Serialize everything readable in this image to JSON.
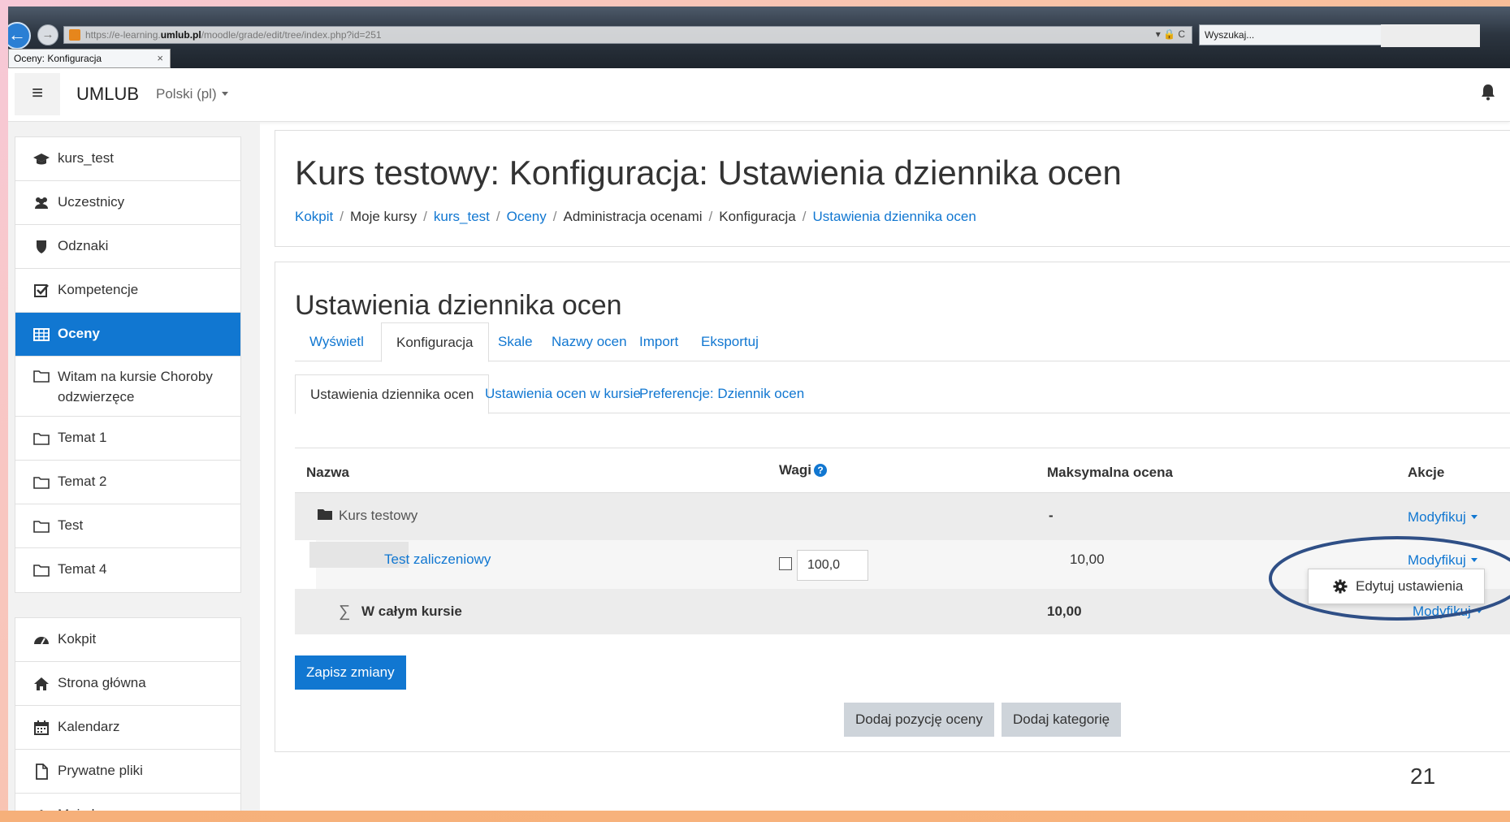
{
  "browser": {
    "url_prefix": "https://e-learning.",
    "url_domain": "umlub.pl",
    "url_path": "/moodle/grade/edit/tree/index.php?id=251",
    "addr_tools": "▾ 🔒 C",
    "search_placeholder": "Wyszukaj...",
    "tab_title": "Oceny: Konfiguracja",
    "tab_close": "×"
  },
  "navbar": {
    "menu_icon": "≡",
    "brand": "UMLUB",
    "language": "Polski (pl)"
  },
  "sidebar": {
    "course_items": [
      {
        "label": "kurs_test",
        "icon": "graduation-cap-icon"
      },
      {
        "label": "Uczestnicy",
        "icon": "users-icon"
      },
      {
        "label": "Odznaki",
        "icon": "shield-icon"
      },
      {
        "label": "Kompetencje",
        "icon": "check-square-icon"
      },
      {
        "label": "Oceny",
        "icon": "table-icon",
        "active": true
      },
      {
        "label": "Witam na kursie Choroby odzwierzęce",
        "icon": "folder-icon"
      },
      {
        "label": "Temat 1",
        "icon": "folder-icon"
      },
      {
        "label": "Temat 2",
        "icon": "folder-icon"
      },
      {
        "label": "Test",
        "icon": "folder-icon"
      },
      {
        "label": "Temat 4",
        "icon": "folder-icon"
      }
    ],
    "site_items": [
      {
        "label": "Kokpit",
        "icon": "dashboard-icon"
      },
      {
        "label": "Strona główna",
        "icon": "home-icon"
      },
      {
        "label": "Kalendarz",
        "icon": "calendar-icon"
      },
      {
        "label": "Prywatne pliki",
        "icon": "file-icon"
      },
      {
        "label": "Moje kursy",
        "icon": "graduation-cap-icon"
      }
    ]
  },
  "header": {
    "title": "Kurs testowy: Konfiguracja: Ustawienia dziennika ocen",
    "breadcrumb": [
      {
        "label": "Kokpit",
        "link": true
      },
      {
        "label": "Moje kursy",
        "link": false
      },
      {
        "label": "kurs_test",
        "link": true
      },
      {
        "label": "Oceny",
        "link": true
      },
      {
        "label": "Administracja ocenami",
        "link": false
      },
      {
        "label": "Konfiguracja",
        "link": false
      },
      {
        "label": "Ustawienia dziennika ocen",
        "link": true
      }
    ],
    "separator": "/"
  },
  "main": {
    "section_title": "Ustawienia dziennika ocen",
    "tabs": [
      "Wyświetl",
      "Konfiguracja",
      "Skale",
      "Nazwy ocen",
      "Import",
      "Eksportuj"
    ],
    "active_tab": "Konfiguracja",
    "subtabs": [
      "Ustawienia dziennika ocen",
      "Ustawienia ocen w kursie",
      "Preferencje: Dziennik ocen"
    ],
    "active_subtab": "Ustawienia dziennika ocen",
    "table": {
      "headers": {
        "name": "Nazwa",
        "weights": "Wagi",
        "max_grade": "Maksymalna ocena",
        "actions": "Akcje"
      },
      "help_glyph": "?",
      "category": {
        "name": "Kurs testowy",
        "max_grade": "-",
        "action": "Modyfikuj"
      },
      "item": {
        "name": "Test zaliczeniowy",
        "weight": "100,0",
        "max_grade": "10,00",
        "action": "Modyfikuj"
      },
      "total": {
        "sigma": "∑",
        "name": "W całym kursie",
        "max_grade": "10,00",
        "action": "Modyfikuj"
      }
    },
    "save_button": "Zapisz zmiany",
    "add_grade_item_button": "Dodaj pozycję oceny",
    "add_category_button": "Dodaj kategorię",
    "dropdown_item": "Edytuj ustawienia"
  },
  "slide_number": "21",
  "colors": {
    "accent": "#1177d1",
    "highlight_ring": "#2f4f86"
  }
}
